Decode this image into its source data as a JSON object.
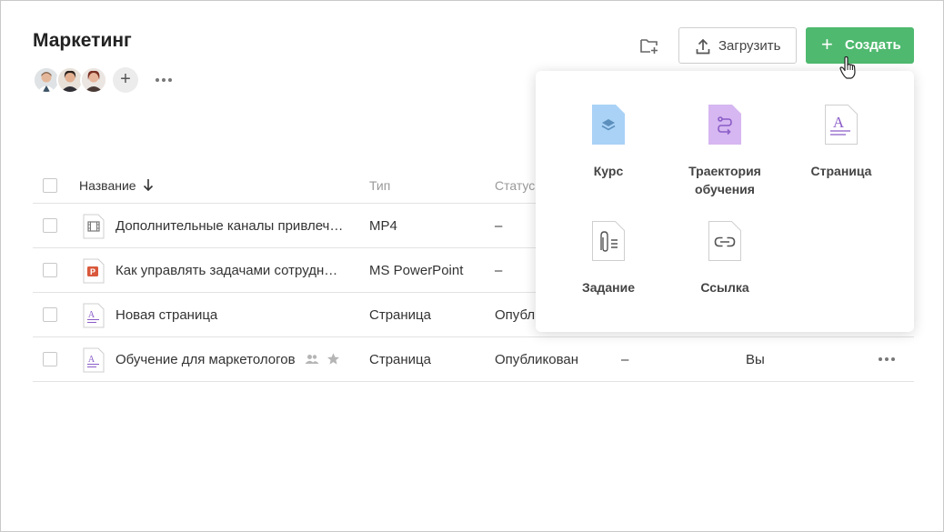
{
  "header": {
    "title": "Маркетинг",
    "add_member_label": "+",
    "upload_label": "Загрузить",
    "create_label": "Создать",
    "create_plus": "+"
  },
  "members": [
    {
      "name": "member-1"
    },
    {
      "name": "member-2"
    },
    {
      "name": "member-3"
    }
  ],
  "table": {
    "columns": {
      "name": "Название",
      "type": "Тип",
      "status": "Статус"
    },
    "rows": [
      {
        "title": "Дополнительные каналы привлеч…",
        "type": "MP4",
        "status": "–",
        "icon": "video-file-icon"
      },
      {
        "title": "Как управлять задачами сотрудн…",
        "type": "MS PowerPoint",
        "status": "–",
        "icon": "powerpoint-file-icon"
      },
      {
        "title": "Новая страница",
        "type": "Страница",
        "status": "Опубли",
        "icon": "page-file-icon"
      },
      {
        "title": "Обучение для маркетологов",
        "type": "Страница",
        "status": "Опубликован",
        "extra": "–",
        "owner": "Вы",
        "icon": "page-file-icon"
      }
    ]
  },
  "create_menu": {
    "items": [
      {
        "label": "Курс",
        "icon": "course-icon"
      },
      {
        "label": "Траектория обучения",
        "icon": "learning-path-icon"
      },
      {
        "label": "Страница",
        "icon": "page-icon"
      },
      {
        "label": "Задание",
        "icon": "assignment-icon"
      },
      {
        "label": "Ссылка",
        "icon": "link-icon"
      }
    ]
  },
  "colors": {
    "accent": "#4fb96f",
    "course": "#a9d2f6",
    "learning_path": "#d6b7f1",
    "page_accent": "#8a5cc7",
    "powerpoint": "#d9583b"
  }
}
